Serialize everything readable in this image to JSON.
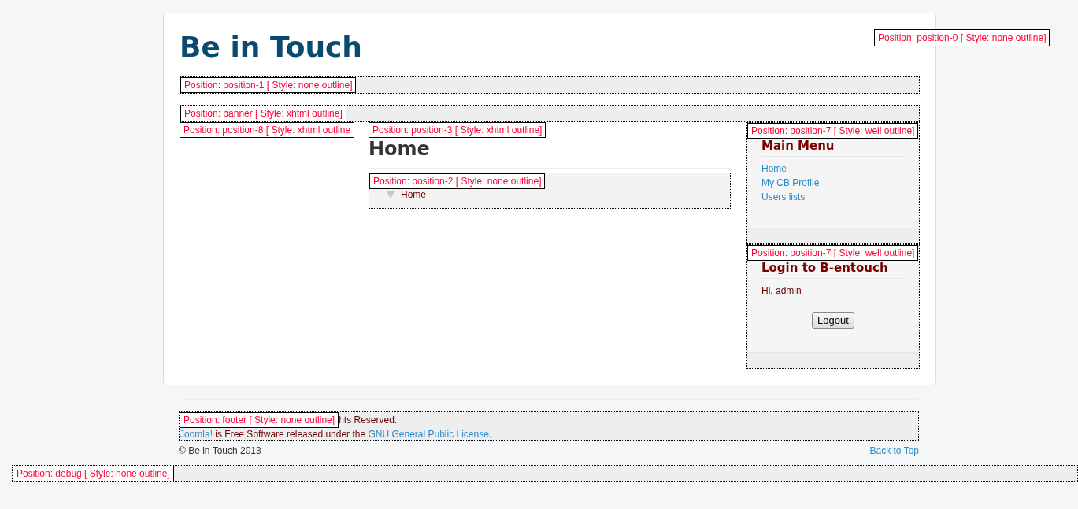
{
  "header": {
    "title": "Be in Touch",
    "position_0": "Position: position-0 [ Style: none outline]"
  },
  "position_1": "Position: position-1 [ Style: none outline]",
  "banner": "Position: banner [ Style: xhtml outline]",
  "left": {
    "position_8": "Position: position-8 [ Style: xhtml outline"
  },
  "content": {
    "position_3": "Position: position-3 [ Style: xhtml outline]",
    "heading": "Home",
    "position_2": "Position: position-2 [ Style: none outline]",
    "breadcrumb": "Home"
  },
  "sidebar": [
    {
      "kind": "menu",
      "position_label": "Position: position-7 [ Style: well outline]",
      "title": "Main Menu",
      "links": [
        "Home",
        "My CB Profile",
        "Users lists"
      ]
    },
    {
      "kind": "login",
      "position_label": "Position: position-7 [ Style: well outline]",
      "title": "Login to B-entouch",
      "greeting": "Hi, admin",
      "button": "Logout"
    }
  ],
  "footer": {
    "position_label": "Position: footer [ Style: none outline]",
    "reserved": "hts Reserved.",
    "license_link_1": "Joomla!",
    "license_text": " is Free Software released under the ",
    "license_link_2": "GNU General Public License.",
    "copyright": "© Be in Touch 2013",
    "back_to_top": "Back to Top"
  },
  "debug": "Position: debug [ Style: none outline]"
}
